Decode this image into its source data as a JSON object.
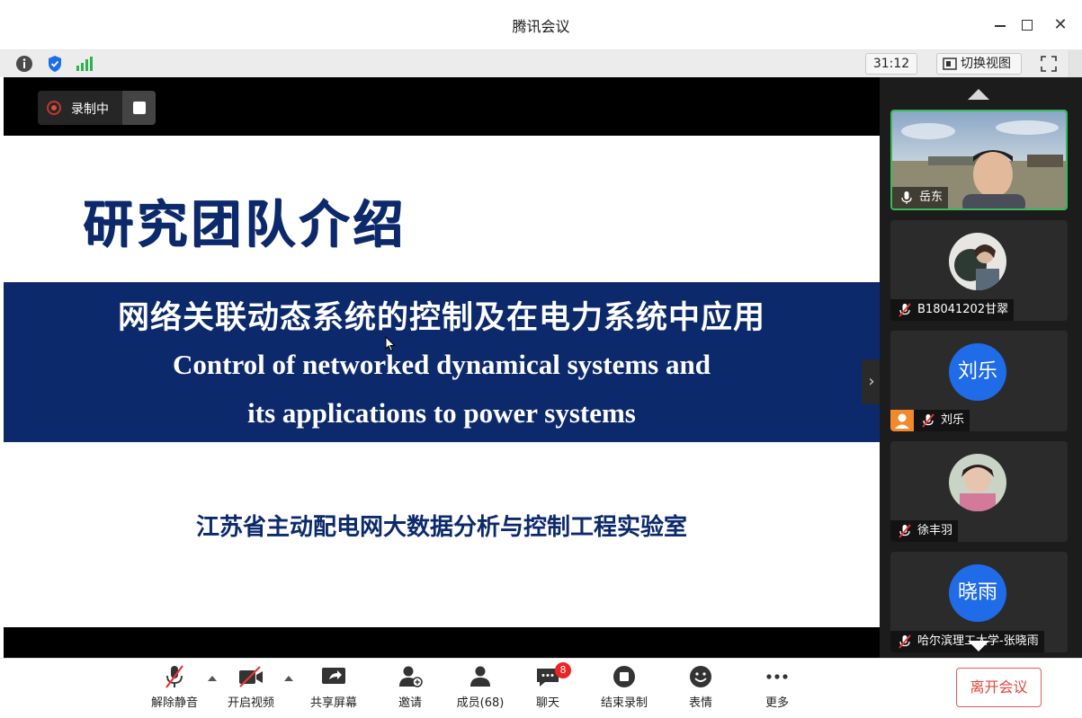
{
  "window": {
    "title": "腾讯会议",
    "minimize_icon": "minimize-icon",
    "maximize_icon": "maximize-icon",
    "close_icon": "close-icon"
  },
  "infobar": {
    "icons": [
      "info-icon",
      "shield-icon",
      "signal-icon"
    ],
    "timer": "31:12",
    "switch_view_label": "切换视图",
    "fullscreen_icon": "fullscreen-icon"
  },
  "recording": {
    "label": "录制中"
  },
  "slide": {
    "title": "研究团队介绍",
    "band_cn": "网络关联动态系统的控制及在电力系统中应用",
    "band_en_line1": "Control of networked dynamical systems and",
    "band_en_line2": "its applications to power systems",
    "lab": "江苏省主动配电网大数据分析与控制工程实验室",
    "colors": {
      "navy": "#0c2a6b",
      "white": "#ffffff"
    }
  },
  "participants": [
    {
      "name": "岳东",
      "mic": "on",
      "active": true,
      "avatar": "video"
    },
    {
      "name": "B18041202甘翠",
      "mic": "muted",
      "avatar": "photo"
    },
    {
      "name": "刘乐",
      "mic": "muted",
      "avatar": "刘乐",
      "host": true
    },
    {
      "name": "徐丰羽",
      "mic": "muted",
      "avatar": "photo"
    },
    {
      "name": "哈尔滨理工大学-张晓雨",
      "mic": "muted",
      "avatar": "晓雨"
    }
  ],
  "toolbar": {
    "unmute": "解除静音",
    "start_video": "开启视频",
    "share_screen": "共享屏幕",
    "invite": "邀请",
    "members": "成员(68)",
    "chat": "聊天",
    "chat_badge": "8",
    "end_recording": "结束录制",
    "reactions": "表情",
    "more": "更多",
    "leave": "离开会议"
  }
}
